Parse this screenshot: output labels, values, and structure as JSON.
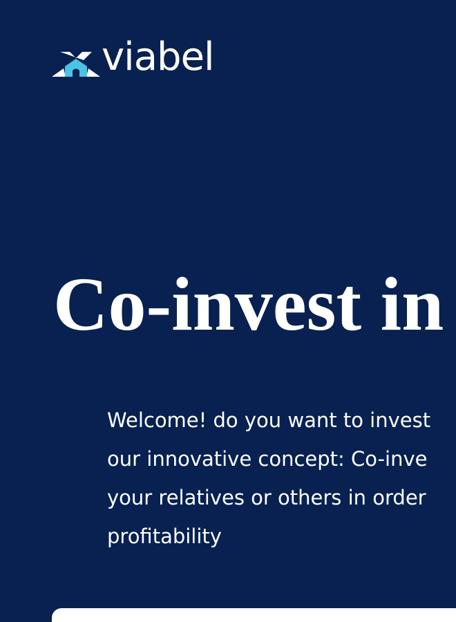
{
  "header": {
    "logo_text": "viabel"
  },
  "hero": {
    "title": "Co-invest in",
    "intro_lines": [
      "Welcome! do you want to invest",
      "our innovative concept: Co-inve",
      "your relatives or others in order",
      "profitability"
    ]
  },
  "colors": {
    "background": "#082150",
    "logo_accent": "#4cc3e5",
    "text": "#ffffff"
  }
}
